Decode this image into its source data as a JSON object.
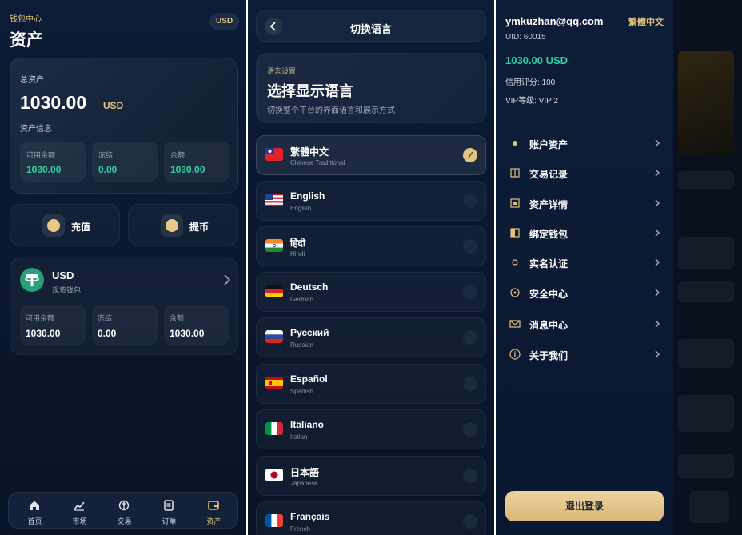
{
  "assets": {
    "subtitle": "钱包中心",
    "title": "资产",
    "currency_pill": "USD",
    "total_label": "总资产",
    "total_amount": "1030.00",
    "total_unit": "USD",
    "info_label": "资产信息",
    "summary": [
      {
        "label": "可用余额",
        "value": "1030.00"
      },
      {
        "label": "冻结",
        "value": "0.00"
      },
      {
        "label": "余额",
        "value": "1030.00"
      }
    ],
    "deposit_label": "充值",
    "withdraw_label": "提币",
    "wallet": {
      "name": "USD",
      "sub": "现货钱包",
      "stats": [
        {
          "label": "可用余额",
          "value": "1030.00"
        },
        {
          "label": "冻结",
          "value": "0.00"
        },
        {
          "label": "余额",
          "value": "1030.00"
        }
      ]
    },
    "nav": [
      {
        "label": "首页",
        "icon": "home-icon"
      },
      {
        "label": "市场",
        "icon": "chart-icon"
      },
      {
        "label": "交易",
        "icon": "trade-icon"
      },
      {
        "label": "订单",
        "icon": "orders-icon"
      },
      {
        "label": "资产",
        "icon": "wallet-icon"
      }
    ]
  },
  "language": {
    "header_title": "切换语言",
    "intro_kicker": "语言设置",
    "intro_title": "选择显示语言",
    "intro_desc": "切换整个平台的界面语言和展示方式",
    "selected_index": 0,
    "items": [
      {
        "name": "繁體中文",
        "sub": "Chinese Traditional",
        "flag": "taiwan"
      },
      {
        "name": "English",
        "sub": "English",
        "flag": "usa"
      },
      {
        "name": "हिंदी",
        "sub": "Hindi",
        "flag": "india"
      },
      {
        "name": "Deutsch",
        "sub": "German",
        "flag": "germany"
      },
      {
        "name": "Русский",
        "sub": "Russian",
        "flag": "russia"
      },
      {
        "name": "Español",
        "sub": "Spanish",
        "flag": "spain"
      },
      {
        "name": "Italiano",
        "sub": "Italian",
        "flag": "italy"
      },
      {
        "name": "日本語",
        "sub": "Japanese",
        "flag": "japan"
      },
      {
        "name": "Français",
        "sub": "French",
        "flag": "france"
      }
    ]
  },
  "profile": {
    "email": "ymkuzhan@qq.com",
    "language_link": "繁體中文",
    "uid": "UID: 60015",
    "balance": "1030.00 USD",
    "credit": "信用评分: 100",
    "vip": "VIP等级: VIP 2",
    "menu": [
      {
        "label": "账户资产",
        "icon": "dot-icon"
      },
      {
        "label": "交易记录",
        "icon": "book-icon"
      },
      {
        "label": "资产详情",
        "icon": "square-icon"
      },
      {
        "label": "绑定钱包",
        "icon": "wallet-icon"
      },
      {
        "label": "实名认证",
        "icon": "circle-icon"
      },
      {
        "label": "安全中心",
        "icon": "shield-icon"
      },
      {
        "label": "消息中心",
        "icon": "mail-icon"
      },
      {
        "label": "关于我们",
        "icon": "info-icon"
      }
    ],
    "logout_label": "退出登录"
  },
  "colors": {
    "accent_gold": "#e3c27e",
    "positive_green": "#2ed3a0",
    "background": "#0a1830"
  }
}
